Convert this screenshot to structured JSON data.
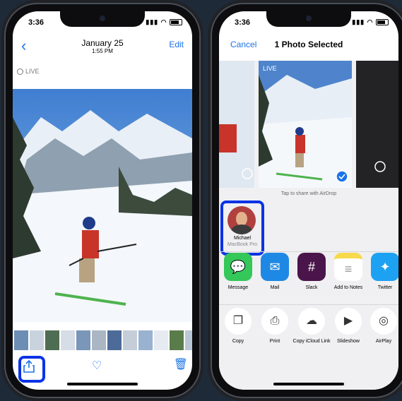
{
  "left_phone": {
    "status": {
      "time": "3:36"
    },
    "nav": {
      "back_icon": "chevron-left-icon",
      "title": "January 25",
      "subtitle": "1:55 PM",
      "edit_label": "Edit"
    },
    "live_label": "LIVE",
    "toolbar": {
      "share_icon": "share-icon",
      "heart_icon": "heart-icon",
      "trash_icon": "trash-icon"
    }
  },
  "right_phone": {
    "status": {
      "time": "3:36"
    },
    "nav": {
      "cancel_label": "Cancel",
      "title": "1 Photo Selected"
    },
    "live_label": "LIVE",
    "airdrop_hint": "Tap to share with AirDrop",
    "airdrop_person": {
      "name": "Michael",
      "device": "MacBook Pro"
    },
    "apps": [
      {
        "label": "Message",
        "icon": "message-icon",
        "color": "#34c759"
      },
      {
        "label": "Mail",
        "icon": "mail-icon",
        "color": "#1e88e5"
      },
      {
        "label": "Slack",
        "icon": "slack-icon",
        "color": "#4a154b"
      },
      {
        "label": "Add to Notes",
        "icon": "notes-icon",
        "color": "#f7d94c"
      },
      {
        "label": "Twitter",
        "icon": "twitter-icon",
        "color": "#1da1f2"
      }
    ],
    "actions": [
      {
        "label": "Copy",
        "icon": "copy-icon"
      },
      {
        "label": "Print",
        "icon": "print-icon"
      },
      {
        "label": "Copy iCloud Link",
        "icon": "cloud-link-icon"
      },
      {
        "label": "Slideshow",
        "icon": "play-icon"
      },
      {
        "label": "AirPlay",
        "icon": "airplay-icon"
      }
    ]
  },
  "colors": {
    "accent": "#1a73e8",
    "highlight": "#0a34e6"
  }
}
